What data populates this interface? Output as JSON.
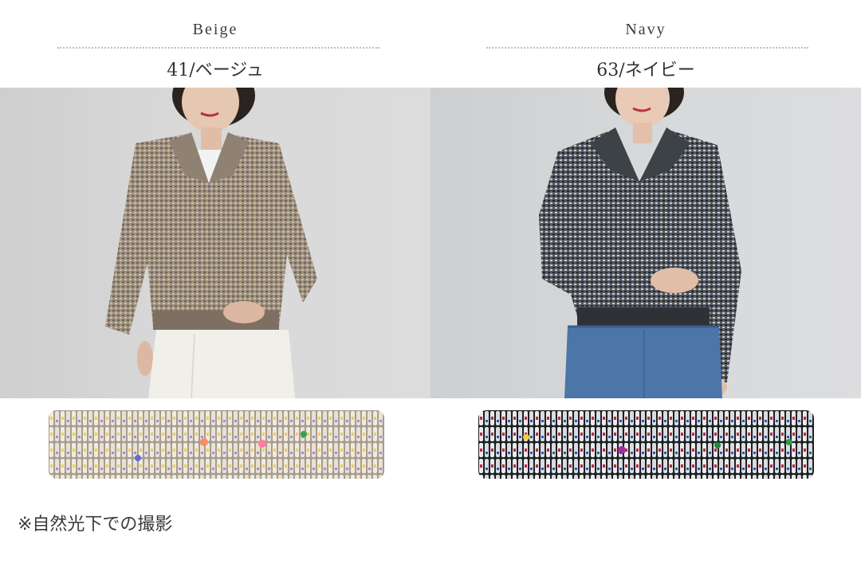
{
  "columns": [
    {
      "color_name_en": "Beige",
      "color_code_jp": "41/ベージュ",
      "photo": "model-beige-knit-polo",
      "swatch": "beige-knit-swatch",
      "palette": {
        "bg": "#d6d6d6",
        "knit": "#9a8c7c",
        "knit_dark": "#6c5f52",
        "pants": "#f3f1ec"
      }
    },
    {
      "color_name_en": "Navy",
      "color_code_jp": "63/ネイビー",
      "photo": "model-navy-knit-polo",
      "swatch": "navy-knit-swatch",
      "palette": {
        "bg": "#d5d7d9",
        "knit": "#555a5e",
        "knit_dark": "#2c3034",
        "pants": "#4c76a8"
      }
    }
  ],
  "note": "※自然光下での撮影"
}
